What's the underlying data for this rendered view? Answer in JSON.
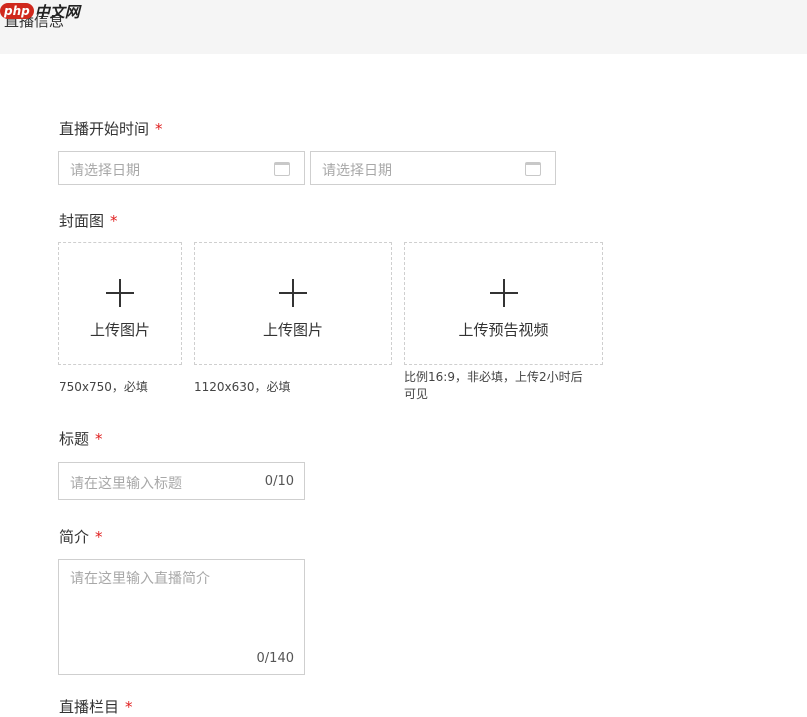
{
  "header": {
    "title": "直播信息"
  },
  "watermark": {
    "php": "php",
    "cn": "中文网"
  },
  "start_time": {
    "label": "直播开始时间",
    "required_mark": "*",
    "start_placeholder": "请选择日期",
    "end_placeholder": "请选择日期"
  },
  "cover": {
    "label": "封面图",
    "required_mark": "*",
    "slots": [
      {
        "text": "上传图片",
        "hint": "750x750，必填"
      },
      {
        "text": "上传图片",
        "hint": "1120x630，必填"
      },
      {
        "text": "上传预告视频",
        "hint": "比例16:9，非必填，上传2小时后可见"
      }
    ]
  },
  "title_field": {
    "label": "标题",
    "required_mark": "*",
    "placeholder": "请在这里输入标题",
    "counter": "0/10"
  },
  "intro_field": {
    "label": "简介",
    "required_mark": "*",
    "placeholder": "请在这里输入直播简介",
    "counter": "0/140"
  },
  "category_field": {
    "label": "直播栏目",
    "required_mark": "*"
  }
}
